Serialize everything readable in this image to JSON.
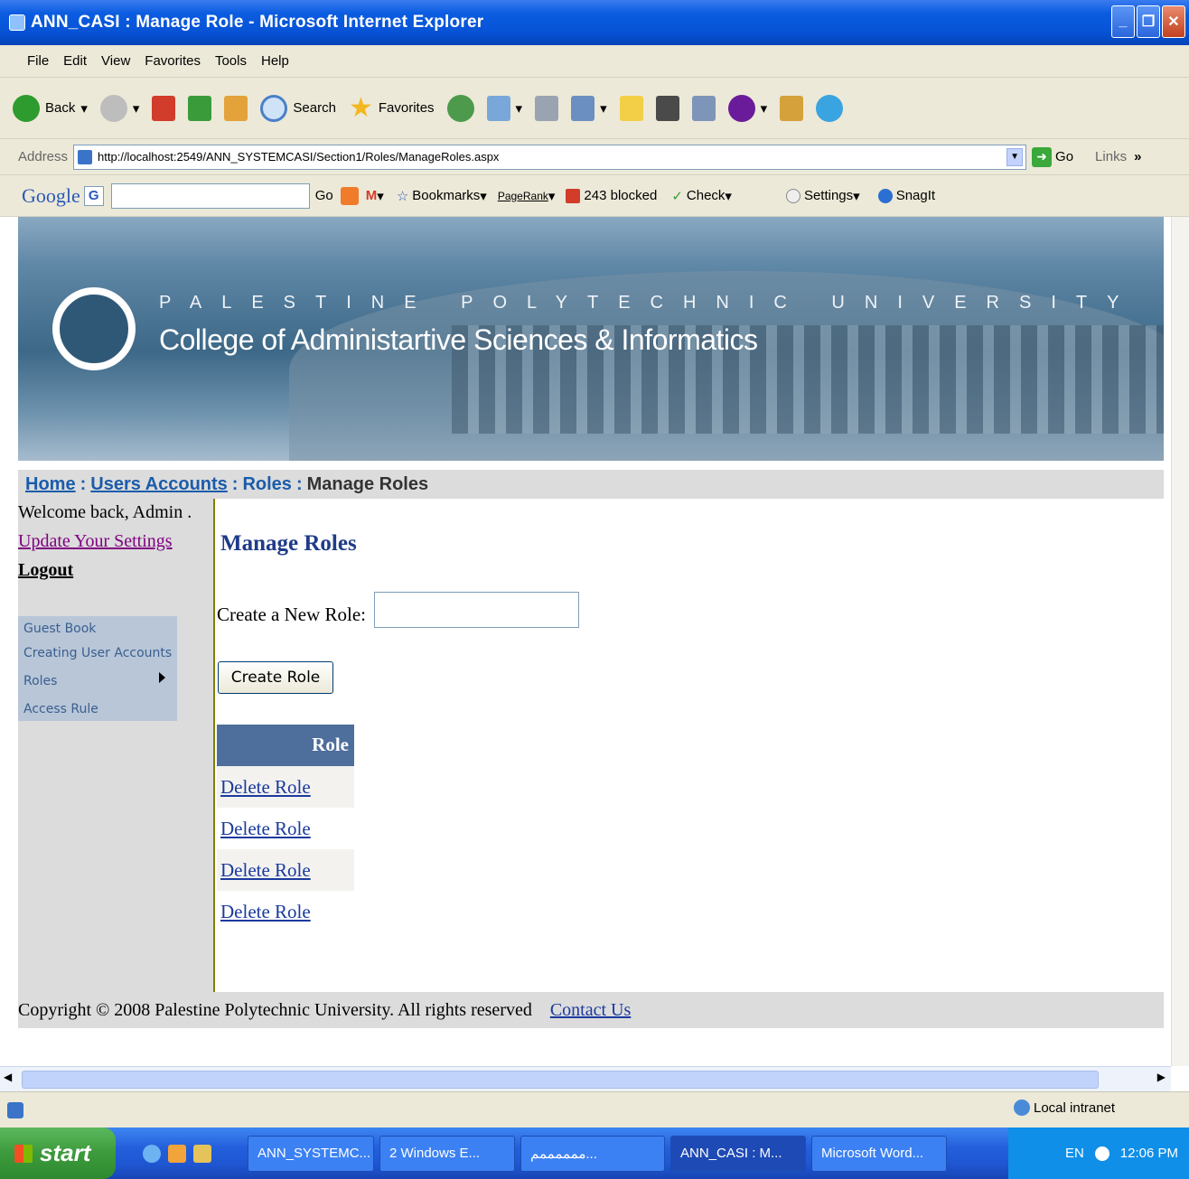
{
  "window": {
    "title": "ANN_CASI : Manage Role - Microsoft Internet Explorer"
  },
  "menu": [
    "File",
    "Edit",
    "View",
    "Favorites",
    "Tools",
    "Help"
  ],
  "toolbar": {
    "back": "Back",
    "search": "Search",
    "favorites": "Favorites"
  },
  "address": {
    "label": "Address",
    "url": "http://localhost:2549/ANN_SYSTEMCASI/Section1/Roles/ManageRoles.aspx",
    "go": "Go",
    "links": "Links"
  },
  "googlebar": {
    "logo": "Google",
    "go": "Go",
    "bookmarks": "Bookmarks",
    "pagerank": "PageRank",
    "blocked": "243 blocked",
    "check": "Check",
    "settings": "Settings",
    "snagit": "SnagIt"
  },
  "banner": {
    "university": "PALESTINE POLYTECHNIC UNIVERSITY",
    "college": "College of Administartive Sciences & Informatics"
  },
  "breadcrumb": {
    "home": "Home",
    "users": "Users Accounts",
    "roles": "Roles",
    "current": "Manage Roles",
    "sep": ":"
  },
  "sidebar": {
    "welcome": "Welcome back, Admin .",
    "settings": "Update Your Settings",
    "logout": "Logout",
    "items": [
      "Guest Book",
      "Creating User Accounts",
      "Roles",
      "Access Rule"
    ]
  },
  "main": {
    "heading": "Manage Roles",
    "new_role_label": "Create a New Role:",
    "new_role_value": "",
    "create_button": "Create Role",
    "table_header": "Role",
    "rows": [
      "Delete Role",
      "Delete Role",
      "Delete Role",
      "Delete Role"
    ]
  },
  "footer": {
    "copyright": "Copyright © 2008 Palestine Polytechnic University. All rights reserved",
    "contact": "Contact Us"
  },
  "status": {
    "zone": "Local intranet"
  },
  "taskbar": {
    "start": "start",
    "tasks": [
      "ANN_SYSTEMC...",
      "2 Windows E...",
      "ممممممم...",
      "ANN_CASI : M...",
      "Microsoft Word..."
    ],
    "lang": "EN",
    "clock": "12:06 PM"
  }
}
